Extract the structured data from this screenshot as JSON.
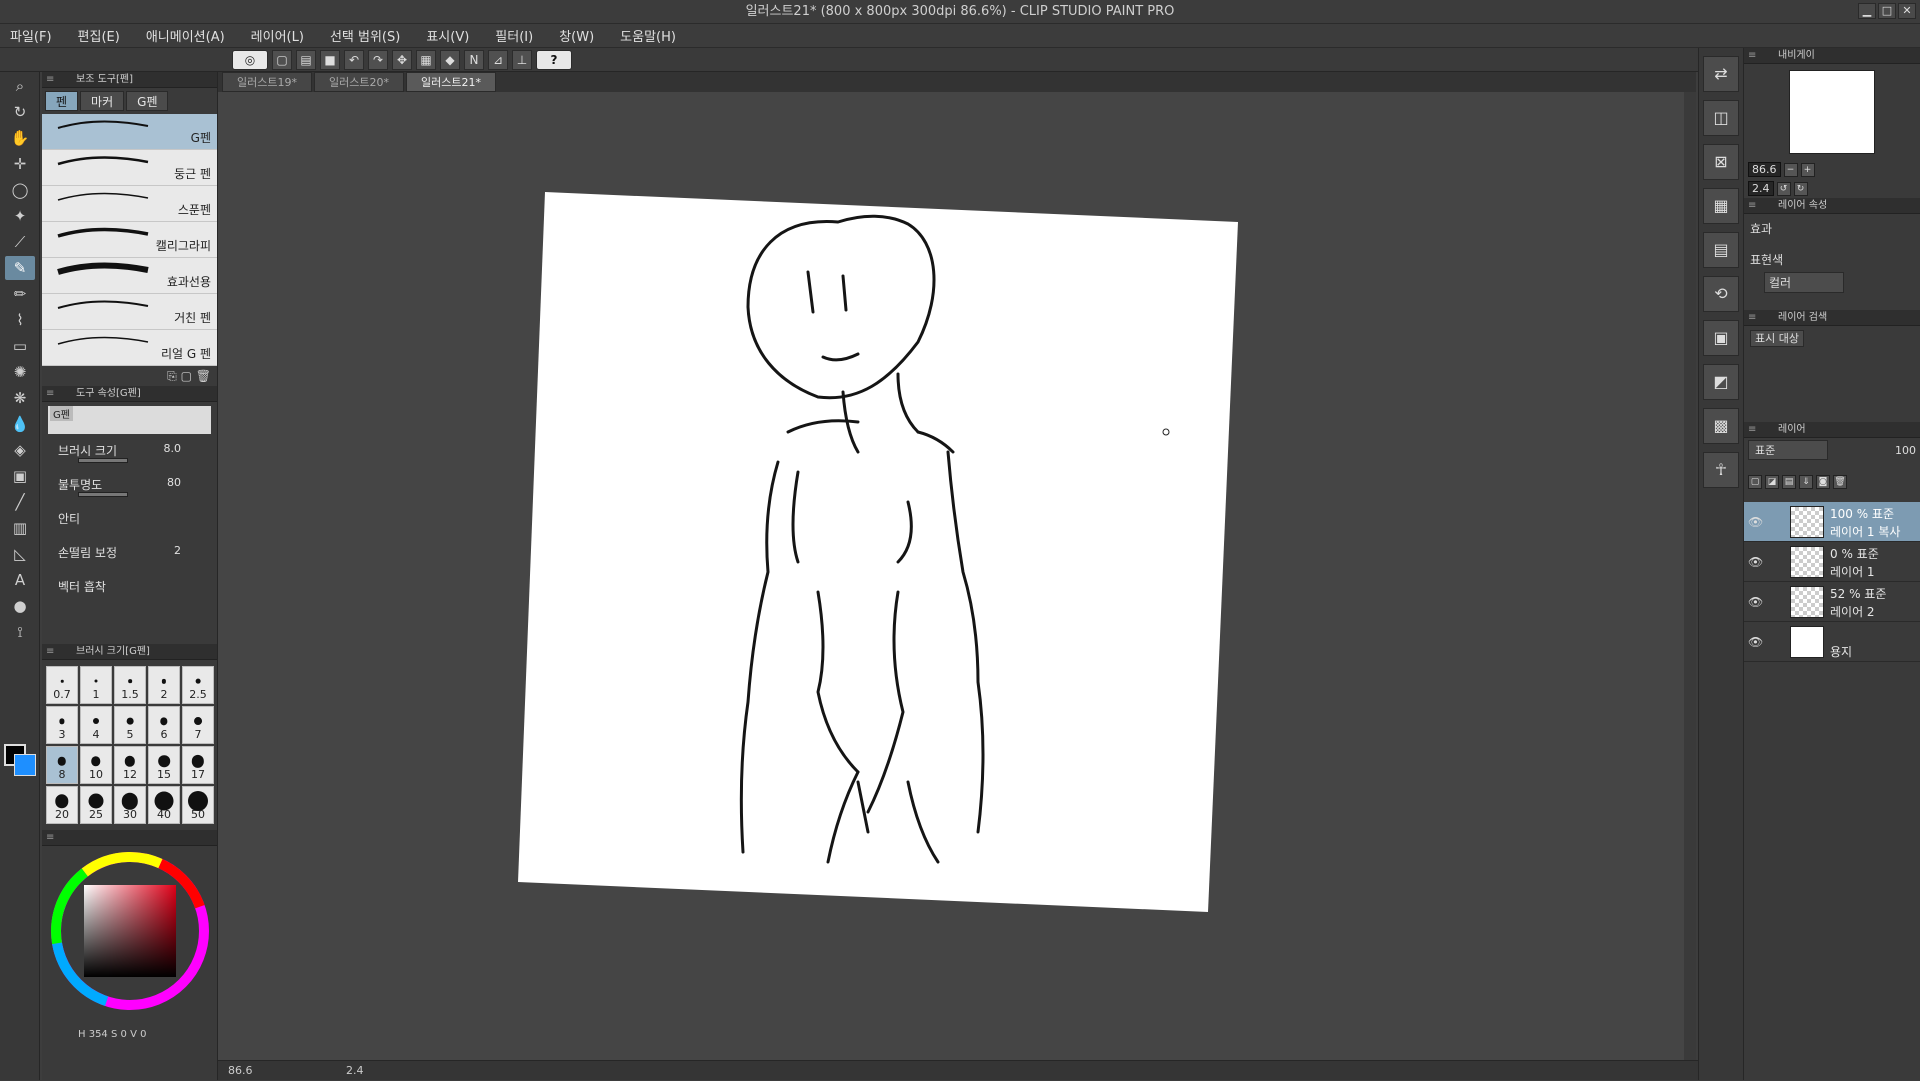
{
  "window": {
    "title": "일러스트21* (800 x 800px 300dpi 86.6%)  - CLIP STUDIO PAINT PRO"
  },
  "menu": [
    "파일(F)",
    "편집(E)",
    "애니메이션(A)",
    "레이어(L)",
    "선택 범위(S)",
    "표시(V)",
    "필터(I)",
    "창(W)",
    "도움말(H)"
  ],
  "doc_tabs": [
    "일러스트19*",
    "일러스트20*",
    "일러스트21*"
  ],
  "sub_tool_panel": {
    "title": "보조 도구[펜]",
    "tabs": [
      "펜",
      "마커",
      "G펜"
    ],
    "brushes": [
      "G펜",
      "둥근 펜",
      "스푼펜",
      "캘리그라피",
      "효과선용",
      "거친 펜",
      "리얼 G 펜"
    ]
  },
  "tool_property": {
    "title": "도구 속성[G펜]",
    "preview_name": "G펜",
    "brush_size_label": "브러시 크기",
    "brush_size_value": "8.0",
    "opacity_label": "불투명도",
    "opacity_value": "80",
    "antialias_label": "안티",
    "stabilization_label": "손떨림 보정",
    "stabilization_value": "2",
    "vector_label": "벡터 흡착"
  },
  "brush_size_panel": {
    "title": "브러시 크기[G펜]",
    "sizes": [
      "0.7",
      "1",
      "1.5",
      "2",
      "2.5",
      "3",
      "4",
      "5",
      "6",
      "7",
      "8",
      "10",
      "12",
      "15",
      "17",
      "20",
      "25",
      "30",
      "40",
      "50"
    ],
    "selected": "8"
  },
  "color": {
    "fg": "#000000",
    "bg": "#1e8fff",
    "hue_value": "354",
    "v_value": "0",
    "s_value": "0"
  },
  "navigator": {
    "title": "내비게이",
    "zoom": "86.6",
    "rotation": "2.4"
  },
  "layer_property": {
    "title": "레이어 속성",
    "effect_label": "효과",
    "color_label": "표현색",
    "color_value": "컬러"
  },
  "layer_search": {
    "title": "레이어 검색",
    "filter": "표시 대상"
  },
  "layers_panel": {
    "title": "레이어",
    "blend_mode": "표준",
    "opacity": "100",
    "layers": [
      {
        "line1": "100 % 표준",
        "line2": "레이어 1 복사"
      },
      {
        "line1": "0 % 표준",
        "line2": "레이어 1"
      },
      {
        "line1": "52 % 표준",
        "line2": "레이어 2"
      },
      {
        "line1": "",
        "line2": "용지"
      }
    ]
  },
  "status": {
    "zoom": "86.6",
    "rotation": "2.4"
  }
}
